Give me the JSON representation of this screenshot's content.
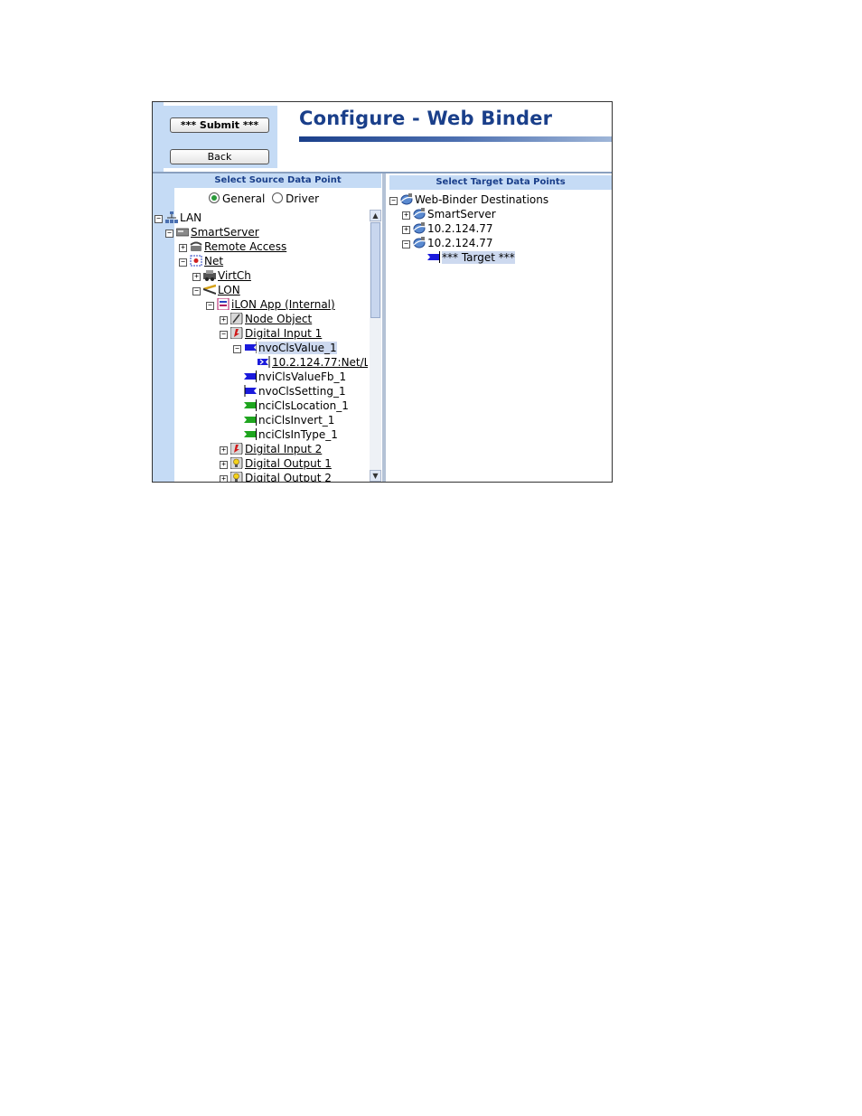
{
  "header": {
    "title": "Configure - Web Binder",
    "submit_label": "*** Submit ***",
    "back_label": "Back"
  },
  "source_panel": {
    "title": "Select Source Data Point",
    "radio_general": "General",
    "radio_driver": "Driver",
    "selected_mode": "General",
    "tree": {
      "lan": "LAN",
      "smartserver": "SmartServer",
      "remote_access": "Remote Access",
      "net": "Net",
      "virtch": "VirtCh",
      "lon": "LON",
      "ilon_app": "iLON App (Internal)",
      "node_object": "Node Object",
      "digital_input_1": "Digital Input 1",
      "nvo_cls_value": "nvoClsValue_1",
      "binding_target": "10.2.124.77:Net/L",
      "nvi_cls_value_fb": "nviClsValueFb_1",
      "nvo_cls_setting": "nvoClsSetting_1",
      "nci_cls_location": "nciClsLocation_1",
      "nci_cls_invert": "nciClsInvert_1",
      "nci_cls_in_type": "nciClsInType_1",
      "digital_input_2": "Digital Input 2",
      "digital_output_1": "Digital Output 1",
      "digital_output_2": "Digital Output 2"
    }
  },
  "target_panel": {
    "title": "Select Target Data Points",
    "tree": {
      "root": "Web-Binder Destinations",
      "smartserver": "SmartServer",
      "host_a": "10.2.124.77",
      "host_b": "10.2.124.77",
      "target": "*** Target ***"
    }
  },
  "colors": {
    "panel_blue": "#c5dbf5",
    "title_blue": "#1a3f8a",
    "input_flag": "#1a1adc",
    "config_flag": "#1fa51f"
  },
  "icons": [
    "network-icon",
    "server-icon",
    "phone-icon",
    "net-icon",
    "virtual-channel-icon",
    "lon-icon",
    "app-icon",
    "node-object-icon",
    "digital-input-icon",
    "digital-output-icon",
    "output-flag-icon",
    "input-flag-icon",
    "config-flag-icon",
    "binding-icon",
    "globe-icon"
  ]
}
